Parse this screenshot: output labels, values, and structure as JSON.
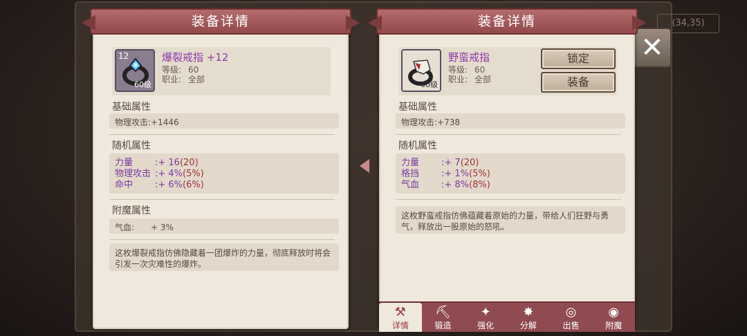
{
  "background": {
    "coords": "(34,35)"
  },
  "left_panel": {
    "title": "装备详情",
    "item": {
      "level_badge": "12",
      "level_tag": "60级",
      "name": "爆裂戒指 +12",
      "level_label": "等级:",
      "level": "60",
      "job_label": "职业:",
      "job": "全部"
    },
    "base_title": "基础属性",
    "base_stat": "物理攻击:+1446",
    "random_title": "随机属性",
    "random_stats": [
      {
        "name": "力量",
        "value": ":+ 16",
        "max": "(20)"
      },
      {
        "name": "物理攻击",
        "value": ":+ 4%",
        "max": "(5%)"
      },
      {
        "name": "命中",
        "value": ":+ 6%",
        "max": "(6%)"
      }
    ],
    "enchant_title": "附魔属性",
    "enchant_stat_name": "气血:",
    "enchant_stat_value": "+ 3%",
    "description": "这枚爆裂戒指仿佛隐藏着一团爆炸的力量，彻底释放时将会引发一次灾难性的爆炸。"
  },
  "right_panel": {
    "title": "装备详情",
    "item": {
      "level_tag": "60级",
      "name": "野蛮戒指",
      "level_label": "等级:",
      "level": "60",
      "job_label": "职业:",
      "job": "全部"
    },
    "lock_label": "锁定",
    "equip_label": "装备",
    "base_title": "基础属性",
    "base_stat": "物理攻击:+738",
    "random_title": "随机属性",
    "random_stats": [
      {
        "name": "力量",
        "value": ":+ 7",
        "max": "(20)"
      },
      {
        "name": "格挡",
        "value": ":+ 1%",
        "max": "(5%)"
      },
      {
        "name": "气血",
        "value": ":+ 8%",
        "max": "(8%)"
      }
    ],
    "description": "这枚野蛮戒指仿佛蕴藏着原始的力量，带给人们狂野与勇气，释放出一股原始的怒吼。"
  },
  "tabs": [
    {
      "label": "详情",
      "icon": "hammer-icon"
    },
    {
      "label": "锻造",
      "icon": "anvil-icon"
    },
    {
      "label": "强化",
      "icon": "wand-icon"
    },
    {
      "label": "分解",
      "icon": "burst-icon"
    },
    {
      "label": "出售",
      "icon": "coins-icon"
    },
    {
      "label": "附魔",
      "icon": "eye-icon"
    }
  ],
  "colors": {
    "banner": "#a65a5d",
    "panel": "#efe8dc",
    "purple_text": "#7a3aa0",
    "max_text": "#a0323c"
  }
}
